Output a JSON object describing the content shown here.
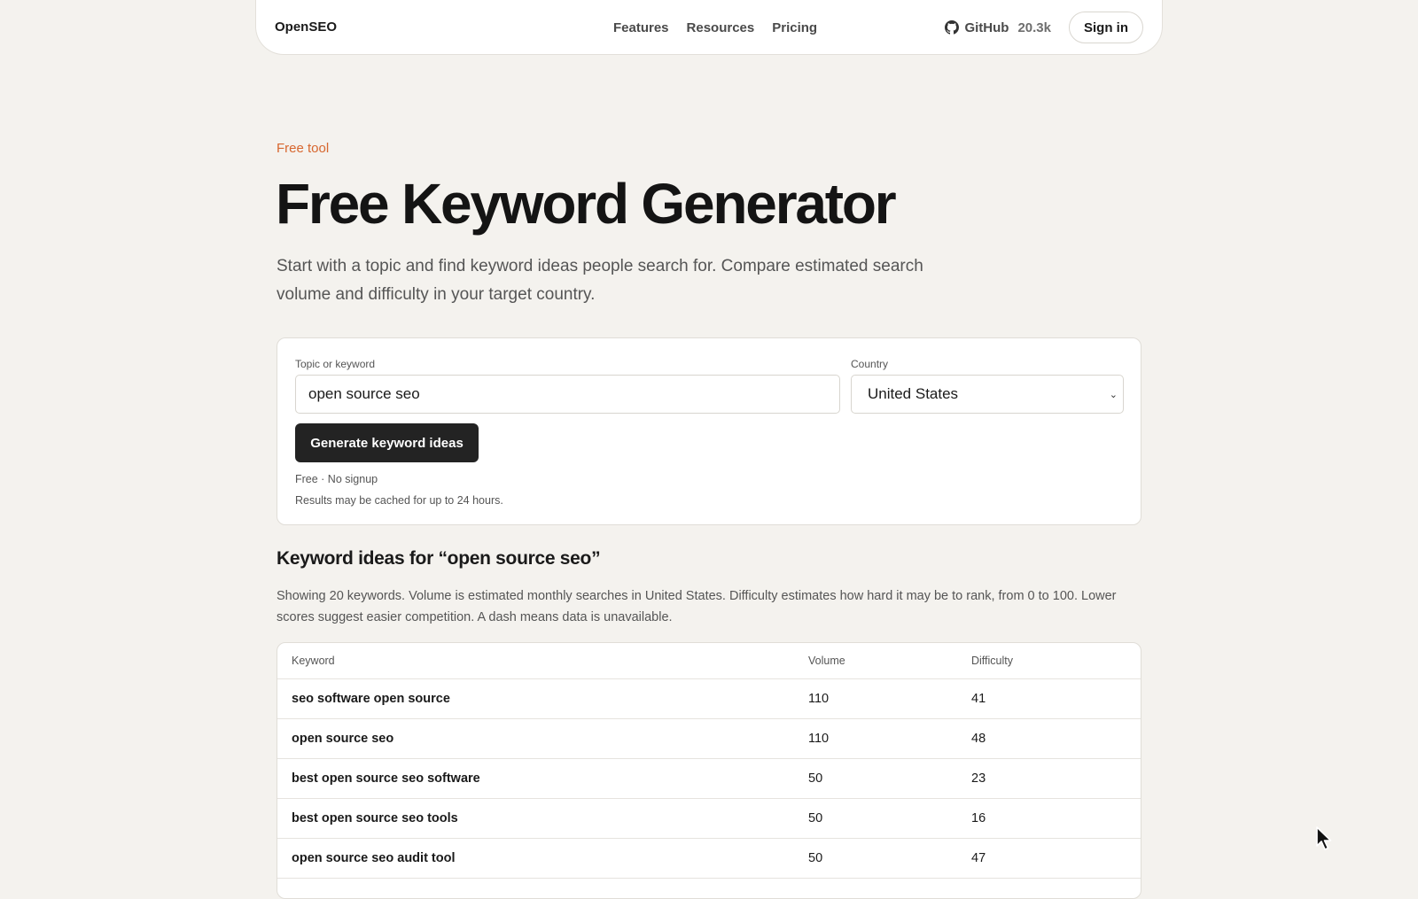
{
  "nav": {
    "logo": "OpenSEO",
    "links": [
      "Features",
      "Resources",
      "Pricing"
    ],
    "github_label": "GitHub",
    "github_stars": "20.3k",
    "signin_label": "Sign in"
  },
  "hero": {
    "eyebrow": "Free tool",
    "title": "Free Keyword Generator",
    "lede": "Start with a topic and find keyword ideas people search for. Compare estimated search volume and difficulty in your target country."
  },
  "form": {
    "topic_label": "Topic or keyword",
    "topic_value": "open source seo",
    "country_label": "Country",
    "country_value": "United States",
    "button_label": "Generate keyword ideas",
    "note1": "Free · No signup",
    "note2": "Results may be cached for up to 24 hours."
  },
  "results": {
    "title": "Keyword ideas for “open source seo”",
    "description": "Showing 20 keywords. Volume is estimated monthly searches in United States. Difficulty estimates how hard it may be to rank, from 0 to 100. Lower scores suggest easier competition. A dash means data is unavailable.",
    "columns": [
      "Keyword",
      "Volume",
      "Difficulty"
    ],
    "rows": [
      {
        "keyword": "seo software open source",
        "volume": "110",
        "difficulty": "41"
      },
      {
        "keyword": "open source seo",
        "volume": "110",
        "difficulty": "48"
      },
      {
        "keyword": "best open source seo software",
        "volume": "50",
        "difficulty": "23"
      },
      {
        "keyword": "best open source seo tools",
        "volume": "50",
        "difficulty": "16"
      },
      {
        "keyword": "open source seo audit tool",
        "volume": "50",
        "difficulty": "47"
      }
    ]
  },
  "colors": {
    "accent": "#d7672f",
    "background": "#f4f2ee",
    "button": "#232323"
  }
}
